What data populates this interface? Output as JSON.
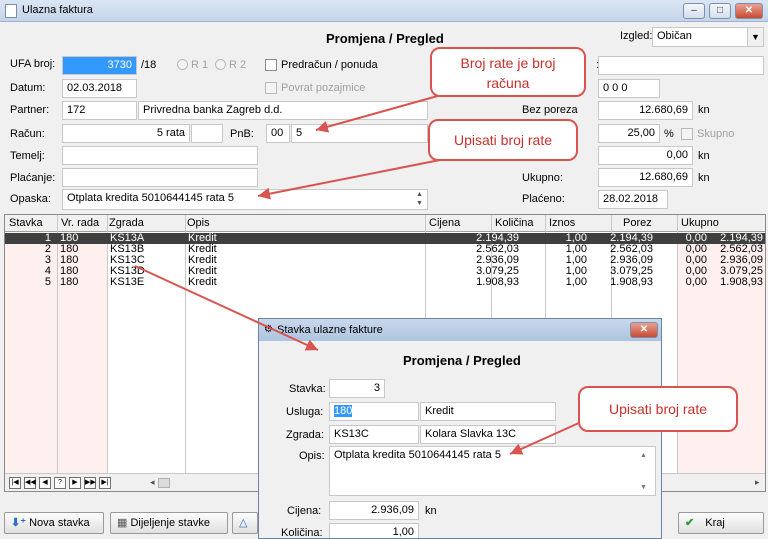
{
  "window": {
    "title": "Ulazna faktura"
  },
  "header": {
    "heading": "Promjena / Pregled",
    "izgled_label": "Izgled:",
    "izgled_value": "Običan"
  },
  "form": {
    "ufa_label": "UFA broj:",
    "ufa_value": "3730",
    "ufa_suffix": "/18",
    "r1": "R 1",
    "r2": "R 2",
    "predracun": "Predračun / ponuda",
    "povrat": "Povrat pozajmice",
    "datum_label": "Datum:",
    "datum_value": "02.03.2018",
    "partner_label": "Partner:",
    "partner_id": "172",
    "partner_name": "Privredna banka Zagreb d.d.",
    "racun_label": "Račun:",
    "racun_value": "5 rata",
    "pnb_label": "PnB:",
    "pnb_model": "00",
    "pnb_value": "5",
    "temelj_label": "Temelj:",
    "placanje_label": "Plaćanje:",
    "opaska_label": "Opaska:",
    "opaska_value": "Otplata kredita 5010644145 rata 5",
    "right_label_1": ":",
    "zeros_value": "0 0 0",
    "bez_poreza_label": "Bez poreza",
    "bez_poreza_value": "12.680,69",
    "kn1": "kn",
    "pdv_value": "25,00",
    "pct": "%",
    "skupno": "Skupno",
    "porez_value": "0,00",
    "kn2": "kn",
    "ukupno_label": "Ukupno:",
    "ukupno_value": "12.680,69",
    "kn3": "kn",
    "placeno_label": "Plaćeno:",
    "placeno_value": "28.02.2018"
  },
  "grid": {
    "columns": [
      "Stavka",
      "Vr. rada",
      "Zgrada",
      "Opis",
      "Cijena",
      "Količina",
      "Iznos",
      "Porez",
      "Ukupno"
    ],
    "rows": [
      {
        "stavka": "1",
        "vr": "180",
        "zgrada": "KS13A",
        "opis": "Kredit",
        "cijena": "2.194,39",
        "kolicina": "1,00",
        "iznos": "2.194,39",
        "porez": "0,00",
        "ukupno": "2.194,39"
      },
      {
        "stavka": "2",
        "vr": "180",
        "zgrada": "KS13B",
        "opis": "Kredit",
        "cijena": "2.562,03",
        "kolicina": "1,00",
        "iznos": "2.562,03",
        "porez": "0,00",
        "ukupno": "2.562,03"
      },
      {
        "stavka": "3",
        "vr": "180",
        "zgrada": "KS13C",
        "opis": "Kredit",
        "cijena": "2.936,09",
        "kolicina": "1,00",
        "iznos": "2.936,09",
        "porez": "0,00",
        "ukupno": "2.936,09"
      },
      {
        "stavka": "4",
        "vr": "180",
        "zgrada": "KS13D",
        "opis": "Kredit",
        "cijena": "3.079,25",
        "kolicina": "1,00",
        "iznos": "3.079,25",
        "porez": "0,00",
        "ukupno": "3.079,25"
      },
      {
        "stavka": "5",
        "vr": "180",
        "zgrada": "KS13E",
        "opis": "Kredit",
        "cijena": "1.908,93",
        "kolicina": "1,00",
        "iznos": "1.908,93",
        "porez": "0,00",
        "ukupno": "1.908,93"
      }
    ],
    "nav": [
      "|◀",
      "◀◀",
      "◀",
      "?",
      "▶",
      "▶▶",
      "▶|"
    ]
  },
  "buttons": {
    "nova_stavka": "Nova stavka",
    "dijeljenje": "Dijeljenje stavke",
    "kraj": "Kraj"
  },
  "dialog": {
    "title": "Stavka ulazne fakture",
    "heading": "Promjena / Pregled",
    "stavka_label": "Stavka:",
    "stavka_value": "3",
    "usluga_label": "Usluga:",
    "usluga_code": "180",
    "usluga_name": "Kredit",
    "zgrada_label": "Zgrada:",
    "zgrada_code": "KS13C",
    "zgrada_name": "Kolara Slavka 13C",
    "opis_label": "Opis:",
    "opis_value": "Otplata kredita 5010644145 rata 5",
    "cijena_label": "Cijena:",
    "cijena_value": "2.936,09",
    "kn": "kn",
    "kolicina_label": "Količina:",
    "kolicina_value": "1,00"
  },
  "callouts": {
    "c1": "Broj rate je broj računa",
    "c2": "Upisati broj rate",
    "c3": "Upisati broj rate"
  },
  "colors": {
    "accent_red": "#d9534f",
    "selection": "#3399ff",
    "row_selected": "#3f3f3f",
    "pink_columns": "#fff0f0"
  }
}
